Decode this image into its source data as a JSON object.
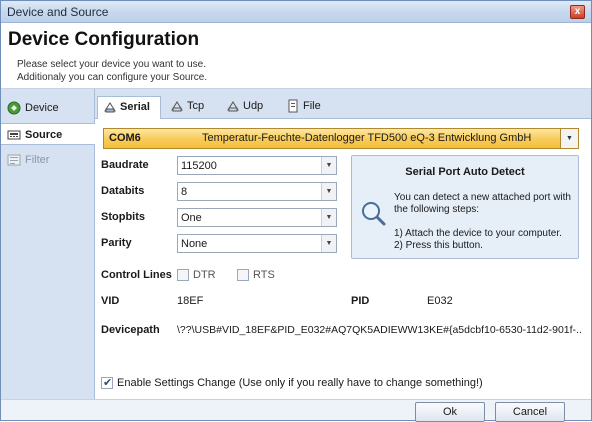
{
  "window": {
    "title": "Device and Source",
    "close_glyph": "x"
  },
  "header": {
    "title": "Device Configuration",
    "line1": "Please select your device you want to use.",
    "line2": "Additionaly you can configure your Source."
  },
  "nav": {
    "items": [
      {
        "label": "Device",
        "icon": "device-icon"
      },
      {
        "label": "Source",
        "icon": "source-icon",
        "selected": true
      },
      {
        "label": "Filter",
        "icon": "filter-icon",
        "disabled": true
      }
    ]
  },
  "tabs": [
    {
      "label": "Serial",
      "icon": "serial-icon",
      "selected": true
    },
    {
      "label": "Tcp",
      "icon": "tcp-icon"
    },
    {
      "label": "Udp",
      "icon": "udp-icon"
    },
    {
      "label": "File",
      "icon": "file-icon"
    }
  ],
  "port_select": {
    "port": "COM6",
    "description": "Temperatur-Feuchte-Datenlogger TFD500 eQ-3 Entwicklung GmbH"
  },
  "settings": {
    "baudrate": {
      "label": "Baudrate",
      "value": "115200"
    },
    "databits": {
      "label": "Databits",
      "value": "8"
    },
    "stopbits": {
      "label": "Stopbits",
      "value": "One"
    },
    "parity": {
      "label": "Parity",
      "value": "None"
    }
  },
  "control_lines": {
    "label": "Control Lines",
    "dtr": "DTR",
    "rts": "RTS",
    "dtr_checked": false,
    "rts_checked": false
  },
  "ids": {
    "vid_label": "VID",
    "vid": "18EF",
    "pid_label": "PID",
    "pid": "E032"
  },
  "devicepath": {
    "label": "Devicepath",
    "value": "\\??\\USB#VID_18EF&PID_E032#AQ7QK5ADIEWW13KE#{a5dcbf10-6530-11d2-901f-..."
  },
  "auto_detect": {
    "title": "Serial Port Auto Detect",
    "text1": "You can detect a new attached port with the following steps:",
    "text2": "1) Attach the device to your computer.",
    "text3": "2) Press this button."
  },
  "enable_settings": {
    "label": "Enable Settings Change (Use only if you really have to change something!)",
    "checked": true
  },
  "buttons": {
    "ok": "Ok",
    "cancel": "Cancel"
  },
  "colors": {
    "accent": "#f9cd5c",
    "nav_bg": "#d6e2f1",
    "border": "#a9bdd8"
  }
}
